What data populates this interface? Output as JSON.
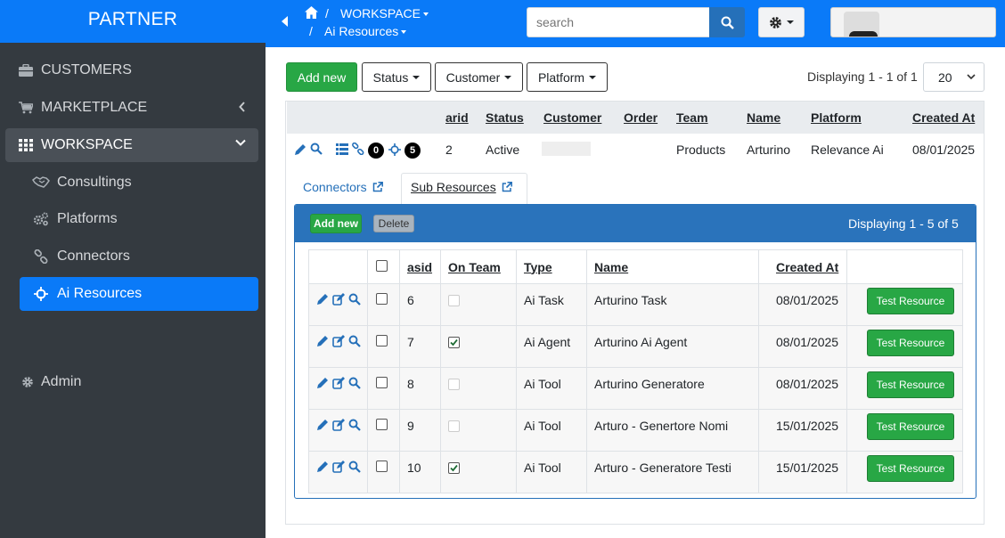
{
  "sidebar": {
    "brand": "PARTNER",
    "items": [
      {
        "label": "CUSTOMERS",
        "icon": "briefcase-icon"
      },
      {
        "label": "MARKETPLACE",
        "icon": "cart-icon"
      },
      {
        "label": "WORKSPACE",
        "icon": "grid-icon"
      }
    ],
    "sub_items": [
      {
        "label": "Consultings",
        "icon": "handshake-icon"
      },
      {
        "label": "Platforms",
        "icon": "cogs-icon"
      },
      {
        "label": "Connectors",
        "icon": "link-icon"
      },
      {
        "label": "Ai Resources",
        "icon": "crosshair-icon"
      }
    ],
    "admin": "Admin"
  },
  "topbar": {
    "breadcrumb_1": "WORKSPACE",
    "breadcrumb_2": "Ai Resources",
    "separator": "/",
    "search_placeholder": "search"
  },
  "toolbar": {
    "add_new": "Add new",
    "filters": [
      "Status",
      "Customer",
      "Platform"
    ],
    "displaying": "Displaying 1 - 1 of 1",
    "page_size": "20"
  },
  "outer_table": {
    "headers": [
      "arid",
      "Status",
      "Customer",
      "Order",
      "Team",
      "Name",
      "Platform",
      "Created At"
    ],
    "row": {
      "badge_a": "0",
      "badge_b": "5",
      "arid": "2",
      "status": "Active",
      "customer": "",
      "order": "",
      "team": "Products",
      "name": "Arturino",
      "platform": "Relevance Ai",
      "created_at": "08/01/2025"
    }
  },
  "tabs": {
    "connectors": "Connectors",
    "sub_resources": "Sub Resources"
  },
  "sub_panel": {
    "add_new": "Add new",
    "delete": "Delete",
    "displaying": "Displaying 1 - 5 of 5",
    "headers": [
      "asid",
      "On Team",
      "Type",
      "Name",
      "Created At"
    ],
    "rows": [
      {
        "asid": "6",
        "on_team": false,
        "type": "Ai Task",
        "name": "Arturino Task",
        "created_at": "08/01/2025",
        "action": "Test Resource"
      },
      {
        "asid": "7",
        "on_team": true,
        "type": "Ai Agent",
        "name": "Arturino Ai Agent",
        "created_at": "08/01/2025",
        "action": "Test Resource"
      },
      {
        "asid": "8",
        "on_team": false,
        "type": "Ai Tool",
        "name": "Arturino Generatore",
        "created_at": "08/01/2025",
        "action": "Test Resource"
      },
      {
        "asid": "9",
        "on_team": false,
        "type": "Ai Tool",
        "name": "Arturo - Genertore Nomi",
        "created_at": "15/01/2025",
        "action": "Test Resource"
      },
      {
        "asid": "10",
        "on_team": true,
        "type": "Ai Tool",
        "name": "Arturo - Generatore Testi",
        "created_at": "15/01/2025",
        "action": "Test Resource"
      }
    ]
  },
  "colors": {
    "primary": "#0a7af8",
    "sidebar": "#343a40",
    "success": "#28a745",
    "panel_head": "#2a73bb"
  }
}
